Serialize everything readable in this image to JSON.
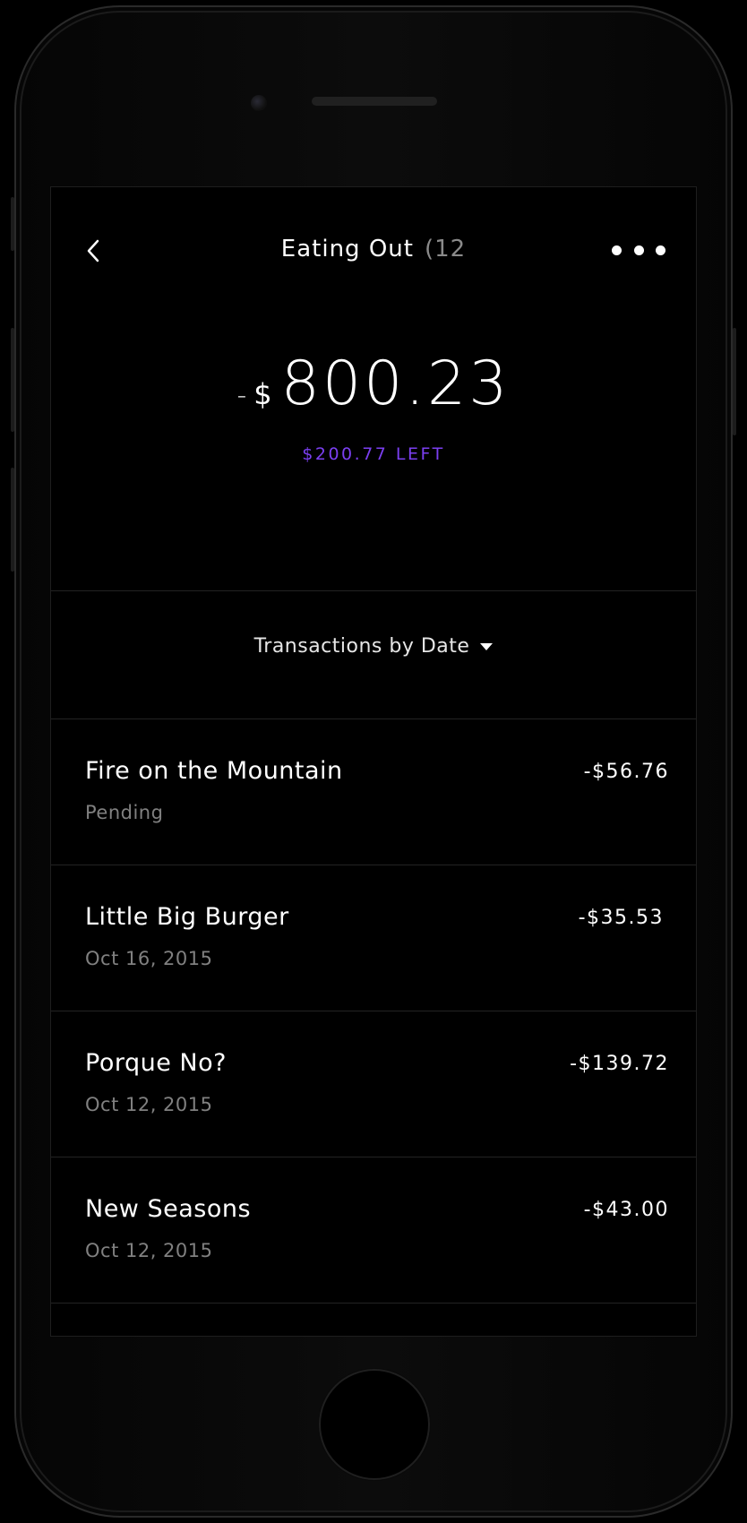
{
  "header": {
    "title": "Eating Out",
    "count": "(12",
    "back_icon": "chevron-left-icon",
    "more_icon": "more-dots-icon"
  },
  "summary": {
    "sign": "-",
    "currency": "$",
    "amount": "800.23",
    "left_label": "$200.77 LEFT",
    "left_color": "#7b3ff1"
  },
  "sort": {
    "label": "Transactions by Date",
    "icon": "caret-down-icon"
  },
  "transactions": [
    {
      "name": "Fire on the Mountain",
      "sub": "Pending",
      "amount": "-$56.76"
    },
    {
      "name": "Little Big Burger",
      "sub": "Oct 16, 2015",
      "amount": "-$35.53"
    },
    {
      "name": "Porque No?",
      "sub": "Oct 12, 2015",
      "amount": "-$139.72"
    },
    {
      "name": "New Seasons",
      "sub": "Oct 12, 2015",
      "amount": "-$43.00"
    }
  ]
}
